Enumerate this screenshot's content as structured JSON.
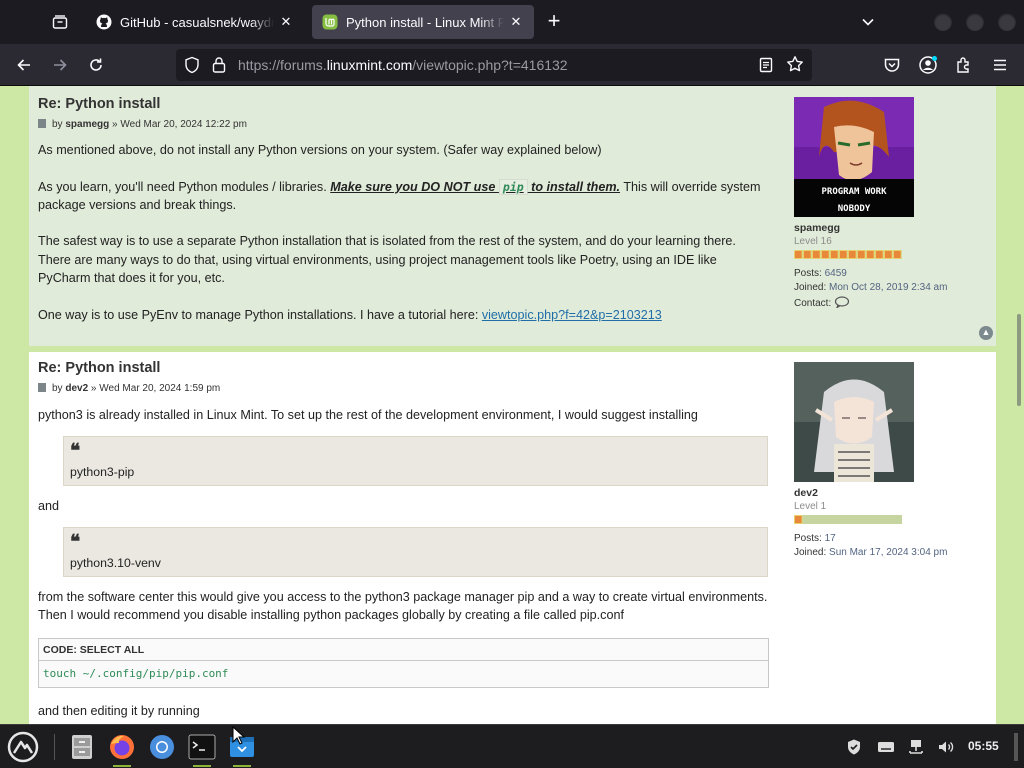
{
  "browser": {
    "tabs": [
      {
        "title": "GitHub - casualsnek/waydroid",
        "close": "✕"
      },
      {
        "title": "Python install - Linux Mint Forums",
        "close": "✕"
      }
    ],
    "new_tab": "+",
    "url_prefix": "https://forums.",
    "url_host": "linuxmint.com",
    "url_path": "/viewtopic.php?t=416132"
  },
  "posts": [
    {
      "title": "Re: Python install",
      "by": "by",
      "author": "spamegg",
      "date": "» Wed Mar 20, 2024 12:22 pm",
      "p1": "As mentioned above, do not install any Python versions on your system. (Safer way explained below)",
      "p2a": "As you learn, you'll need Python modules / libraries. ",
      "p2b": "Make sure you DO NOT use ",
      "p2code": "pip",
      "p2c": " to install them.",
      "p2d": " This will override system package versions and break things.",
      "p3": "The safest way is to use a separate Python installation that is isolated from the rest of the system, and do your learning there. There are many ways to do that, using virtual environments, using project management tools like Poetry, using an IDE like PyCharm that does it for you, etc.",
      "p4": "One way is to use PyEnv to manage Python installations. I have a tutorial here: ",
      "p4link": "viewtopic.php?f=42&p=2103213",
      "profile": {
        "avatar_text_1": "PROGRAM WORK",
        "avatar_text_2": "NOBODY",
        "username": "spamegg",
        "rank": "Level 16",
        "rank_fill": 0.99,
        "posts_label": "Posts:",
        "posts": "6459",
        "joined_label": "Joined:",
        "joined": "Mon Oct 28, 2019 2:34 am",
        "contact_label": "Contact:"
      }
    },
    {
      "title": "Re: Python install",
      "by": "by",
      "author": "dev2",
      "date": "» Wed Mar 20, 2024 1:59 pm",
      "p1": "python3 is already installed in Linux Mint. To set up the rest of the development environment, I would suggest installing",
      "quote1": "python3-pip",
      "and": "and",
      "quote2": "python3.10-venv",
      "p2": "from the software center this would give you access to the python3 package manager pip and a way to create virtual environments. Then I would recommend you disable installing python packages globally by creating a file called pip.conf",
      "code_header": "CODE: SELECT ALL",
      "code": "touch ~/.config/pip/pip.conf",
      "p3": "and then editing it by running",
      "profile": {
        "username": "dev2",
        "rank": "Level 1",
        "rank_fill": 0.06,
        "posts_label": "Posts:",
        "posts": "17",
        "joined_label": "Joined:",
        "joined": "Sun Mar 17, 2024 3:04 pm"
      }
    }
  ],
  "taskbar": {
    "clock": "05:55"
  },
  "colors": {
    "page_bg": "#cde8a4",
    "post_bg_1": "#e1ebd9",
    "post_bg_2": "#ffffff",
    "link": "#1f6ea8",
    "rank_orange": "#e8883a",
    "rank_green": "#c6d5a0"
  }
}
